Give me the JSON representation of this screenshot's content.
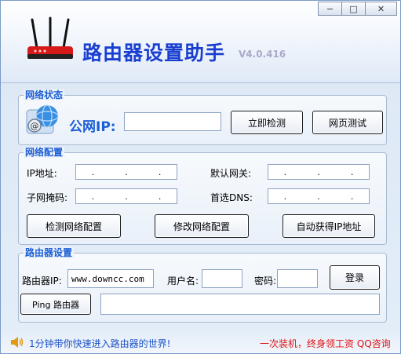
{
  "window": {
    "title": "路由器设置助手",
    "version": "V4.0.416",
    "buttons": {
      "minimize": "−",
      "maximize": "□",
      "close": "✕"
    }
  },
  "network_status": {
    "title": "网络状态",
    "public_ip_label": "公网IP:",
    "public_ip_value": "",
    "detect_button": "立即检测",
    "webtest_button": "网页测试"
  },
  "network_config": {
    "title": "网络配置",
    "ip_label": "IP地址:",
    "gateway_label": "默认网关:",
    "mask_label": "子网掩码:",
    "dns_label": "首选DNS:",
    "ip_dot": ".",
    "detect_config_button": "检测网络配置",
    "modify_config_button": "修改网络配置",
    "auto_ip_button": "自动获得IP地址"
  },
  "router_settings": {
    "title": "路由器设置",
    "router_ip_label": "路由器IP:",
    "router_ip_value": "www.downcc.com",
    "username_label": "用户名:",
    "username_value": "",
    "password_label": "密码:",
    "password_value": "",
    "login_button": "登录",
    "ping_button": "Ping 路由器",
    "ping_output": ""
  },
  "status_bar": {
    "left_text": "1分钟带你快速进入路由器的世界!",
    "right_text": "一次装机，终身领工资  QQ咨询"
  },
  "colors": {
    "title_blue": "#1a3fd0",
    "group_title_blue": "#1c5fd6",
    "status_red": "#e01010",
    "router_red": "#d61a1a"
  }
}
